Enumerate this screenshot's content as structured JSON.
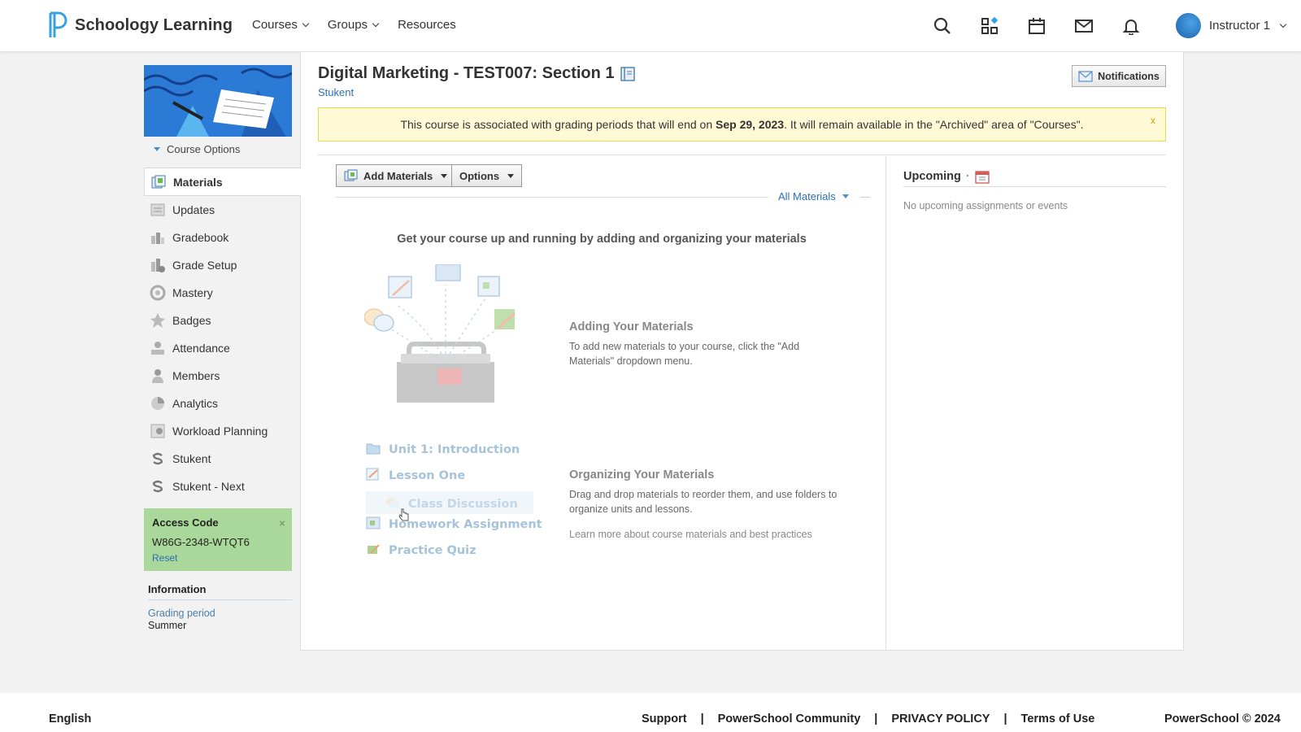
{
  "header": {
    "brand": "Schoology Learning",
    "nav": [
      {
        "label": "Courses",
        "dropdown": true
      },
      {
        "label": "Groups",
        "dropdown": true
      },
      {
        "label": "Resources",
        "dropdown": false
      }
    ],
    "tools": [
      "search-icon",
      "apps-grid-icon",
      "calendar-icon",
      "mail-icon",
      "bell-icon"
    ],
    "user_name": "Instructor 1"
  },
  "sidebar": {
    "course_options": "Course Options",
    "items": [
      {
        "label": "Materials",
        "icon": "materials-icon",
        "active": true
      },
      {
        "label": "Updates",
        "icon": "updates-icon"
      },
      {
        "label": "Gradebook",
        "icon": "gradebook-icon"
      },
      {
        "label": "Grade Setup",
        "icon": "grade-setup-icon"
      },
      {
        "label": "Mastery",
        "icon": "mastery-icon"
      },
      {
        "label": "Badges",
        "icon": "badge-icon"
      },
      {
        "label": "Attendance",
        "icon": "attendance-icon"
      },
      {
        "label": "Members",
        "icon": "members-icon"
      },
      {
        "label": "Analytics",
        "icon": "analytics-icon"
      },
      {
        "label": "Workload Planning",
        "icon": "workload-icon"
      },
      {
        "label": "Stukent",
        "icon": "stukent-icon"
      },
      {
        "label": "Stukent - Next",
        "icon": "stukent-icon"
      }
    ],
    "access": {
      "title": "Access Code",
      "code": "W86G-2348-WTQT6",
      "reset": "Reset",
      "close": "×"
    },
    "info": {
      "title": "Information",
      "link": "Grading period",
      "value": "Summer"
    }
  },
  "course": {
    "title": "Digital Marketing - TEST007: Section 1",
    "subtitle": "Stukent",
    "notifications_button": "Notifications",
    "banner": {
      "pre": "This course is associated with grading periods that will end on ",
      "date": "Sep 29, 2023",
      "post": ". It will remain available in the \"Archived\" area of \"Courses\".",
      "close": "x"
    }
  },
  "materials": {
    "add_button": "Add Materials",
    "options_button": "Options",
    "filter": "All Materials",
    "headline": "Get your course up and running by adding and organizing your materials",
    "adding_title": "Adding Your Materials",
    "adding_text": "To add new materials to your course, click the \"Add Materials\" dropdown menu.",
    "organizing_title": "Organizing Your Materials",
    "organizing_text": "Drag and drop materials to reorder them, and use folders to organize units and lessons.",
    "learn_more": "Learn more about course materials and best practices",
    "demo_items": [
      {
        "label": "Unit 1: Introduction",
        "icon": "folder-icon"
      },
      {
        "label": "Lesson One",
        "icon": "assignment-icon"
      },
      {
        "label": "Class Discussion",
        "icon": "discussion-icon"
      },
      {
        "label": "Homework Assignment",
        "icon": "homework-icon"
      },
      {
        "label": "Practice Quiz",
        "icon": "quiz-icon"
      }
    ]
  },
  "upcoming": {
    "title": "Upcoming",
    "separator": "·",
    "empty": "No upcoming assignments or events"
  },
  "footer": {
    "language": "English",
    "links": [
      "Support",
      "PowerSchool Community",
      "PRIVACY POLICY",
      "Terms of Use"
    ],
    "separator": "|",
    "copyright": "PowerSchool © 2024"
  },
  "colors": {
    "link": "#2f6fb3",
    "banner_bg": "#fff9d6",
    "banner_border": "#f0d64a",
    "access_bg": "#a9d89a"
  }
}
